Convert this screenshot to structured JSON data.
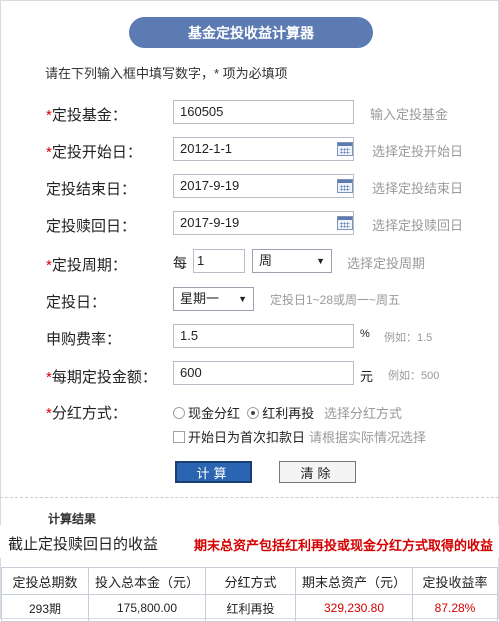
{
  "title": "基金定投收益计算器",
  "intro": "请在下列输入框中填写数字，* 项为必填项",
  "form": {
    "fund": {
      "label": "定投基金：",
      "value": "160505",
      "hint": "输入定投基金"
    },
    "start": {
      "label": "定投开始日：",
      "value": "2012-1-1",
      "hint": "选择定投开始日"
    },
    "end": {
      "label": "定投结束日：",
      "value": "2017-9-19",
      "hint": "选择定投结束日"
    },
    "redeem": {
      "label": "定投赎回日：",
      "value": "2017-9-19",
      "hint": "选择定投赎回日"
    },
    "period": {
      "label": "定投周期：",
      "prefix": "每",
      "value": "1",
      "unit": "周",
      "hint": "选择定投周期"
    },
    "day": {
      "label": "定投日：",
      "value": "星期一",
      "hint": "定投日1~28或周一~周五"
    },
    "fee": {
      "label": "申购费率：",
      "value": "1.5",
      "unit": "%",
      "hint": "例如：1.5"
    },
    "amount": {
      "label": "每期定投金额：",
      "value": "600",
      "unit": "元",
      "hint": "例如：500"
    },
    "dividend": {
      "label": "分红方式：",
      "opt_cash": "现金分红",
      "opt_reinvest": "红利再投",
      "selected": "红利再投",
      "hint": "选择分红方式"
    },
    "first_day": {
      "label": "开始日为首次扣款日",
      "hint": "请根据实际情况选择"
    }
  },
  "buttons": {
    "calc": "计算",
    "clear": "清除"
  },
  "result": {
    "heading": "计算结果",
    "left_text": "截止定投赎回日的收益",
    "right_text": "期末总资产包括红利再投或现金分红方式取得的收益",
    "columns": [
      "定投总期数",
      "投入总本金（元）",
      "分红方式",
      "期末总资产（元）",
      "定投收益率"
    ],
    "values": [
      "293期",
      "175,800.00",
      "红利再投",
      "329,230.80",
      "87.28%"
    ]
  }
}
